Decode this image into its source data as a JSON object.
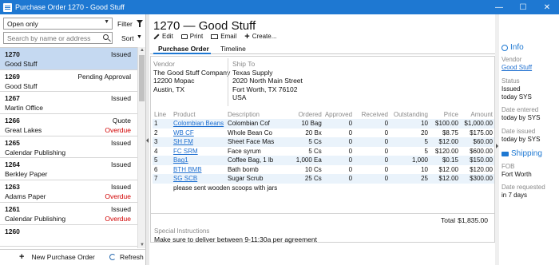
{
  "window": {
    "title": "Purchase Order 1270 - Good Stuff",
    "controls": [
      "—",
      "☐",
      "✕"
    ]
  },
  "left": {
    "filter_select": "Open only",
    "filter_label": "Filter",
    "search_placeholder": "Search by name or address",
    "sort_label": "Sort",
    "items": [
      {
        "number": "1270",
        "status": "Issued",
        "name": "Good Stuff",
        "due": "",
        "selected": true
      },
      {
        "number": "1269",
        "status": "Pending Approval",
        "name": "Good Stuff",
        "due": "",
        "selected": false
      },
      {
        "number": "1267",
        "status": "Issued",
        "name": "Martin Office",
        "due": "",
        "selected": false
      },
      {
        "number": "1266",
        "status": "Quote",
        "name": "Great Lakes",
        "due": "Overdue",
        "selected": false
      },
      {
        "number": "1265",
        "status": "Issued",
        "name": "Calendar Publishing",
        "due": "",
        "selected": false
      },
      {
        "number": "1264",
        "status": "Issued",
        "name": "Berkley Paper",
        "due": "",
        "selected": false
      },
      {
        "number": "1263",
        "status": "Issued",
        "name": "Adams Paper",
        "due": "Overdue",
        "selected": false
      },
      {
        "number": "1261",
        "status": "Issued",
        "name": "Calendar Publishing",
        "due": "Overdue",
        "selected": false
      },
      {
        "number": "1260",
        "status": "",
        "name": "",
        "due": "",
        "selected": false
      }
    ],
    "new_button": "New Purchase Order",
    "refresh_button": "Refresh"
  },
  "main": {
    "heading": "1270 — Good Stuff",
    "toolbar": {
      "edit": "Edit",
      "print": "Print",
      "email": "Email",
      "create": "Create..."
    },
    "tabs": [
      "Purchase Order",
      "Timeline"
    ],
    "vendor": {
      "label": "Vendor",
      "lines": [
        "The Good Stuff Company",
        "12200 Mopac",
        "Austin, TX"
      ]
    },
    "ship_to": {
      "label": "Ship To",
      "lines": [
        "Texas Supply",
        "2020 North Main Street",
        "Fort Worth, TX  76102",
        "USA"
      ]
    },
    "columns": [
      "Line",
      "Product",
      "Description",
      "Ordered",
      "Approved",
      "Received",
      "Outstanding",
      "Price",
      "Amount"
    ],
    "rows": [
      {
        "line": "1",
        "product": "Colombian Beans",
        "description": "Colombian Cof",
        "ordered": "10 Bag",
        "approved": "0",
        "received": "0",
        "outstanding": "10",
        "price": "$100.00",
        "amount": "$1,000.00"
      },
      {
        "line": "2",
        "product": "WB CF",
        "description": "Whole Bean Co",
        "ordered": "20 Bx",
        "approved": "0",
        "received": "0",
        "outstanding": "20",
        "price": "$8.75",
        "amount": "$175.00"
      },
      {
        "line": "3",
        "product": "SH FM",
        "description": "Sheet Face Mas",
        "ordered": "5 Cs",
        "approved": "0",
        "received": "0",
        "outstanding": "5",
        "price": "$12.00",
        "amount": "$60.00"
      },
      {
        "line": "4",
        "product": "FC SRM",
        "description": "Face syrum",
        "ordered": "5 Cs",
        "approved": "0",
        "received": "0",
        "outstanding": "5",
        "price": "$120.00",
        "amount": "$600.00"
      },
      {
        "line": "5",
        "product": "Bag1",
        "description": "Coffee Bag, 1 lb",
        "ordered": "1,000 Ea",
        "approved": "0",
        "received": "0",
        "outstanding": "1,000",
        "price": "$0.15",
        "amount": "$150.00"
      },
      {
        "line": "6",
        "product": "BTH BMB",
        "description": "Bath bomb",
        "ordered": "10 Cs",
        "approved": "0",
        "received": "0",
        "outstanding": "10",
        "price": "$12.00",
        "amount": "$120.00"
      },
      {
        "line": "7",
        "product": "SG SCB",
        "description": "Sugar Scrub",
        "ordered": "25 Cs",
        "approved": "0",
        "received": "0",
        "outstanding": "25",
        "price": "$12.00",
        "amount": "$300.00"
      }
    ],
    "row_note": "please sent wooden scoops with jars",
    "total_label": "Total",
    "total_value": "$1,835.00",
    "special_label": "Special Instructions",
    "special_value": "Make sure to deliver between 9-11:30a per agreement"
  },
  "info": {
    "heading": "Info",
    "vendor_label": "Vendor",
    "vendor_value": "Good Stuff",
    "status_label": "Status",
    "status_value": "Issued",
    "status_sub": "today SYS",
    "entered_label": "Date entered",
    "entered_value": "today by SYS",
    "issued_label": "Date issued",
    "issued_value": "today by SYS"
  },
  "shipping": {
    "heading": "Shipping",
    "fob_label": "FOB",
    "fob_value": "Fort Worth",
    "req_label": "Date requested",
    "req_value": "in 7 days"
  }
}
